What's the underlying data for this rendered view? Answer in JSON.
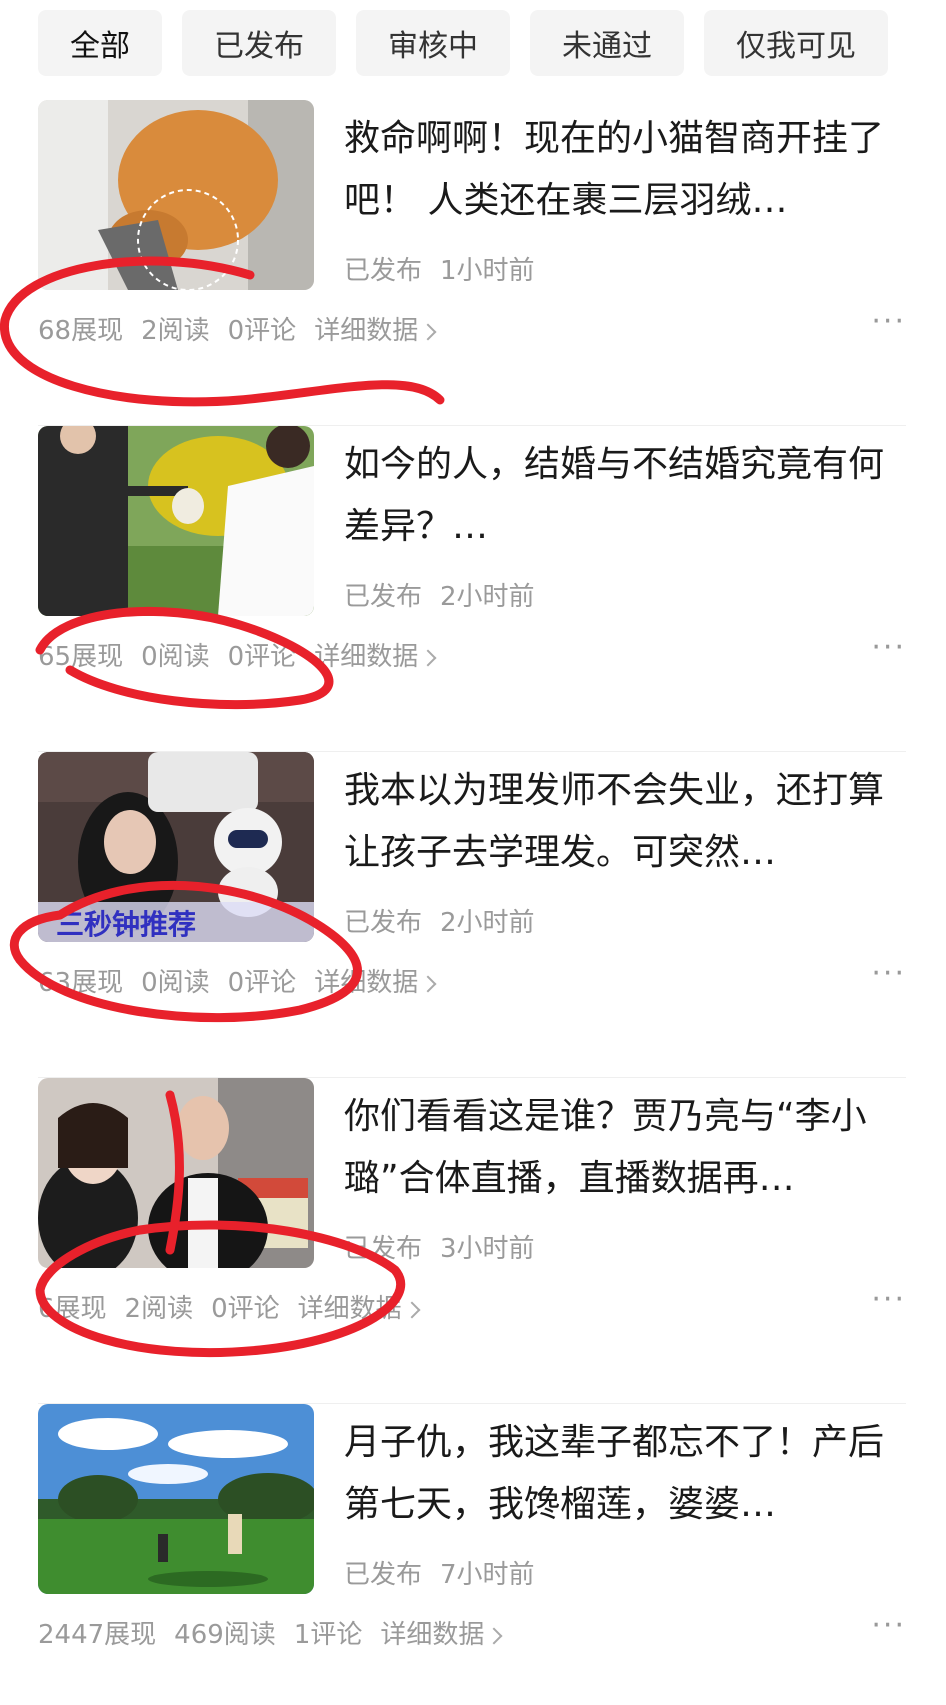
{
  "tabs": [
    {
      "label": "全部"
    },
    {
      "label": "已发布"
    },
    {
      "label": "审核中"
    },
    {
      "label": "未通过"
    },
    {
      "label": "仅我可见"
    }
  ],
  "items": [
    {
      "title": "救命啊啊！现在的小猫智商开挂了吧！ 人类还在裹三层羽绒…",
      "status": "已发布",
      "time": "1小时前",
      "views": "68展现",
      "reads": "2阅读",
      "comments": "0评论",
      "detail": "详细数据"
    },
    {
      "title": "如今的人，结婚与不结婚究竟有何差异？…",
      "status": "已发布",
      "time": "2小时前",
      "views": "65展现",
      "reads": "0阅读",
      "comments": "0评论",
      "detail": "详细数据"
    },
    {
      "title": "我本以为理发师不会失业，还打算让孩子去学理发。可突然…",
      "status": "已发布",
      "time": "2小时前",
      "views": "63展现",
      "reads": "0阅读",
      "comments": "0评论",
      "detail": "详细数据",
      "thumb_caption": "三秒钟推荐"
    },
    {
      "title": "你们看看这是谁？贾乃亮与“李小璐”合体直播，直播数据再…",
      "status": "已发布",
      "time": "3小时前",
      "views": "6展现",
      "reads": "2阅读",
      "comments": "0评论",
      "detail": "详细数据"
    },
    {
      "title": "月子仇，我这辈子都忘不了！产后第七天，我馋榴莲，婆婆…",
      "status": "已发布",
      "time": "7小时前",
      "views": "2447展现",
      "reads": "469阅读",
      "comments": "1评论",
      "detail": "详细数据"
    }
  ],
  "more_icon": "ellipsis-icon",
  "annotation_color": "#e8212b"
}
